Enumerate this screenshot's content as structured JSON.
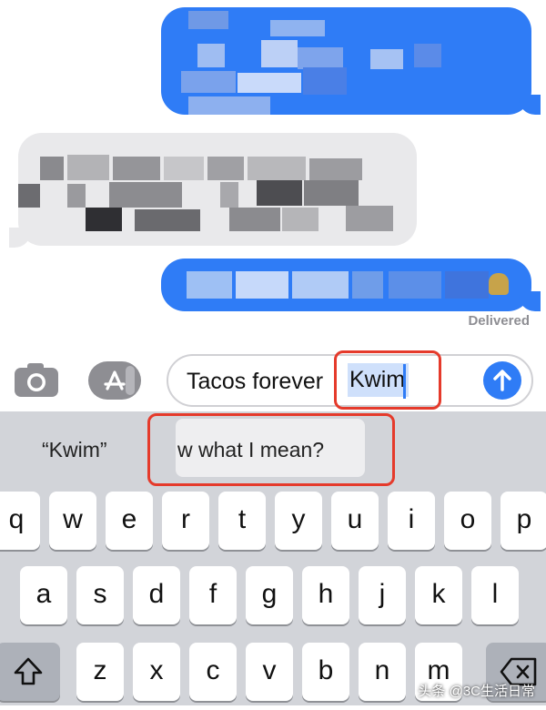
{
  "messages": {
    "status": "Delivered"
  },
  "input_bar": {
    "camera_icon": "camera-icon",
    "apps_icon": "app-store-icon",
    "text_before": "Tacos forever",
    "highlighted_word": "Kwim",
    "send_icon": "arrow-up-icon"
  },
  "keyboard": {
    "suggestions": [
      "“Kwim”",
      "w what I mean?"
    ],
    "row1": [
      "q",
      "w",
      "e",
      "r",
      "t",
      "y",
      "u",
      "i",
      "o",
      "p"
    ],
    "row2": [
      "a",
      "s",
      "d",
      "f",
      "g",
      "h",
      "j",
      "k",
      "l"
    ],
    "row3": [
      "z",
      "x",
      "c",
      "v",
      "b",
      "n",
      "m"
    ]
  },
  "watermark": "头条 @3C生活日常",
  "colors": {
    "accent": "#2f7cf6",
    "highlight_box": "#e53a2b",
    "keyboard_bg": "#d2d4d9"
  }
}
